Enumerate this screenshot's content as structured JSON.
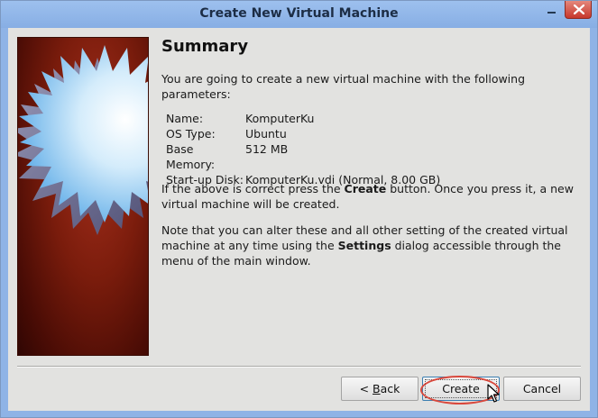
{
  "window": {
    "title": "Create New Virtual Machine"
  },
  "summary": {
    "heading": "Summary",
    "intro": "You are going to create a new virtual machine with the following parameters:",
    "params": [
      {
        "label": "Name:",
        "value": "KomputerKu"
      },
      {
        "label": "OS Type:",
        "value": "Ubuntu"
      },
      {
        "label": "Base Memory:",
        "value": "512 MB"
      },
      {
        "label": "Start-up Disk:",
        "value": "KomputerKu.vdi (Normal, 8.00 GB)"
      }
    ],
    "confirm_before": "If the above is correct press the ",
    "confirm_bold": "Create",
    "confirm_after": " button. Once you press it, a new virtual machine will be created.",
    "note_before": "Note that you can alter these and all other setting of the created virtual machine at any time using the ",
    "note_bold": "Settings",
    "note_after": " dialog accessible through the menu of the main window."
  },
  "buttons": {
    "back_prefix": "< ",
    "back_mnemonic": "B",
    "back_rest": "ack",
    "create": "Create",
    "cancel": "Cancel"
  },
  "colors": {
    "titlebar": "#8fb3e6",
    "close_button": "#c7372b",
    "banner_red": "#7a1c0c",
    "highlight_circle": "#d9483c"
  },
  "icons": {
    "close": "close-icon",
    "minimize": "minimize-icon",
    "cursor": "mouse-pointer-icon",
    "banner": "starburst-logo-icon"
  }
}
